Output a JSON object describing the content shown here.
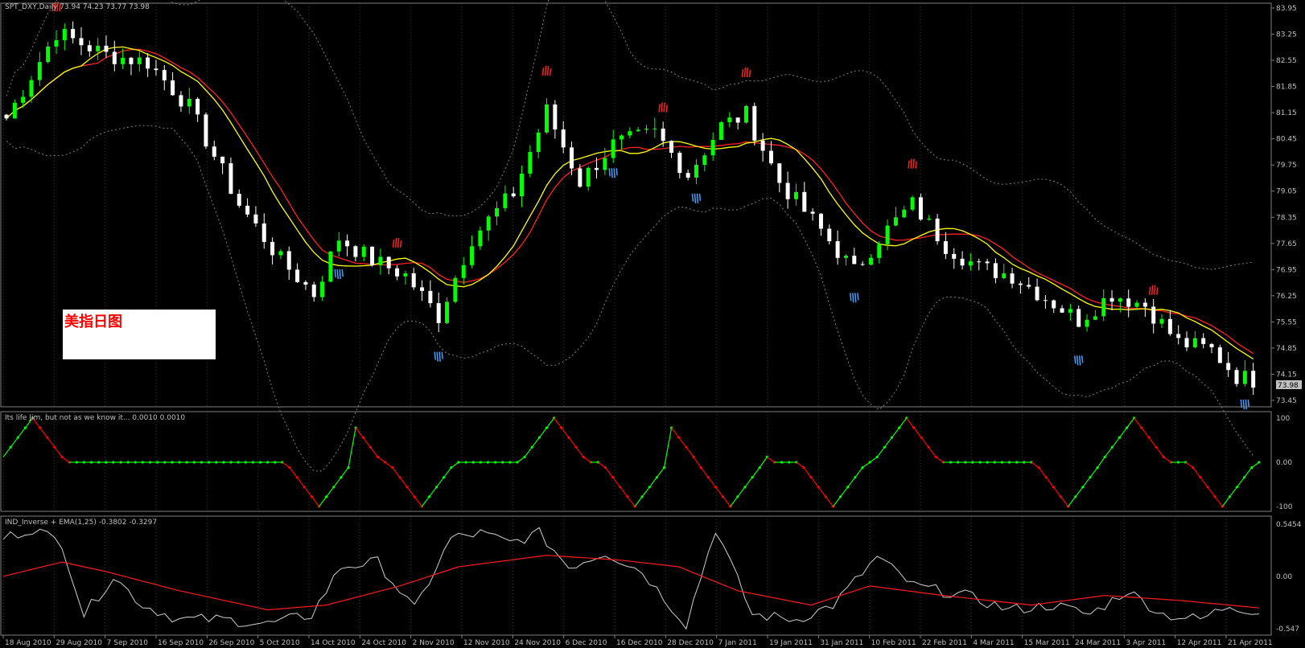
{
  "colors": {
    "background": "#000000",
    "grid": "#3a3a3a",
    "candle_up": "#00ff00",
    "candle_down": "#ffffff",
    "ma_fast": "#ffff00",
    "ma_slow": "#ff2020",
    "ma_signal": "#3fd0ff",
    "band": "#808080",
    "oscillator_up": "#00ff00",
    "oscillator_down": "#ff0000",
    "inverse_line": "#cfcfcf",
    "ema_line": "#ff1a1a",
    "marker_top": "#ff2020",
    "marker_bottom": "#3fa0ff"
  },
  "panes": {
    "main": {
      "title": "SPT_DXY,Daily  73.94 74.23 73.77 73.98",
      "last_price": "73.98",
      "y_labels": [
        "83.95",
        "83.25",
        "82.55",
        "81.85",
        "81.15",
        "80.45",
        "79.75",
        "79.05",
        "78.35",
        "77.65",
        "76.95",
        "76.25",
        "75.55",
        "74.85",
        "74.15",
        "73.45"
      ],
      "note": "美指日图"
    },
    "oscillator": {
      "title": "Its life Jim, but not as we know it...  0.0010 0.0010",
      "y_labels": [
        "100",
        "0.00",
        "-100"
      ]
    },
    "inverse": {
      "title": "IND_Inverse + EMA(1,25) -0.3802 -0.3297",
      "y_labels": [
        "0.5454",
        "0.00",
        "-0.547"
      ]
    }
  },
  "x_labels": [
    "18 Aug 2010",
    "29 Aug 2010",
    "7 Sep 2010",
    "16 Sep 2010",
    "26 Sep 2010",
    "5 Oct 2010",
    "14 Oct 2010",
    "24 Oct 2010",
    "2 Nov 2010",
    "12 Nov 2010",
    "24 Nov 2010",
    "6 Dec 2010",
    "16 Dec 2010",
    "28 Dec 2010",
    "7 Jan 2011",
    "19 Jan 2011",
    "31 Jan 2011",
    "10 Feb 2011",
    "22 Feb 2011",
    "4 Mar 2011",
    "15 Mar 2011",
    "24 Mar 2011",
    "3 Apr 2011",
    "12 Apr 2011",
    "21 Apr 2011"
  ],
  "chart_data": [
    {
      "type": "candlestick",
      "title": "SPT_DXY,Daily",
      "ylim": [
        73.45,
        83.95
      ],
      "anchors": [
        [
          0,
          81.0
        ],
        [
          6,
          83.3
        ],
        [
          12,
          82.7
        ],
        [
          17,
          82.5
        ],
        [
          22,
          81.3
        ],
        [
          28,
          78.7
        ],
        [
          33,
          77.2
        ],
        [
          37,
          76.3
        ],
        [
          40,
          77.8
        ],
        [
          44,
          77.2
        ],
        [
          48,
          76.8
        ],
        [
          52,
          75.7
        ],
        [
          56,
          77.8
        ],
        [
          61,
          79.0
        ],
        [
          65,
          81.2
        ],
        [
          69,
          79.3
        ],
        [
          73,
          80.3
        ],
        [
          78,
          80.6
        ],
        [
          82,
          79.5
        ],
        [
          86,
          80.8
        ],
        [
          89,
          81.1
        ],
        [
          93,
          79.3
        ],
        [
          98,
          78.0
        ],
        [
          102,
          76.9
        ],
        [
          105,
          77.8
        ],
        [
          109,
          78.7
        ],
        [
          113,
          77.6
        ],
        [
          117,
          77.0
        ],
        [
          121,
          76.8
        ],
        [
          125,
          76.2
        ],
        [
          129,
          75.6
        ],
        [
          133,
          76.3
        ],
        [
          137,
          76.0
        ],
        [
          141,
          75.0
        ],
        [
          145,
          74.8
        ],
        [
          148,
          74.1
        ],
        [
          150,
          74.0
        ]
      ],
      "bars": 151
    },
    {
      "type": "line",
      "name": "Its life Jim, but not as we know it...",
      "ylim": [
        -100,
        100
      ],
      "peaks": [
        4,
        47,
        75,
        90,
        100,
        123,
        154
      ],
      "troughs": [
        43,
        57,
        86,
        99,
        113,
        145,
        166
      ]
    },
    {
      "type": "line",
      "name": "IND_Inverse + EMA(1,25)",
      "ylim": [
        -0.547,
        0.5454
      ],
      "inverse_anchors": [
        [
          0,
          0.4
        ],
        [
          4,
          0.5
        ],
        [
          8,
          0.35
        ],
        [
          11,
          -0.4
        ],
        [
          15,
          0.0
        ],
        [
          19,
          -0.3
        ],
        [
          24,
          -0.45
        ],
        [
          30,
          -0.45
        ],
        [
          36,
          -0.5
        ],
        [
          42,
          -0.4
        ],
        [
          46,
          0.1
        ],
        [
          51,
          0.15
        ],
        [
          56,
          -0.35
        ],
        [
          61,
          0.4
        ],
        [
          65,
          0.45
        ],
        [
          69,
          0.35
        ],
        [
          73,
          0.45
        ],
        [
          77,
          0.1
        ],
        [
          82,
          0.25
        ],
        [
          87,
          0.05
        ],
        [
          93,
          -0.5
        ],
        [
          97,
          0.5
        ],
        [
          102,
          -0.4
        ],
        [
          108,
          -0.45
        ],
        [
          113,
          -0.3
        ],
        [
          119,
          0.2
        ],
        [
          124,
          -0.1
        ],
        [
          131,
          -0.2
        ],
        [
          137,
          -0.35
        ],
        [
          143,
          -0.3
        ],
        [
          148,
          -0.4
        ],
        [
          153,
          -0.15
        ],
        [
          158,
          -0.4
        ],
        [
          163,
          -0.45
        ],
        [
          167,
          -0.3
        ],
        [
          171,
          -0.38
        ]
      ],
      "ema_anchors": [
        [
          0,
          0.0
        ],
        [
          8,
          0.15
        ],
        [
          14,
          0.05
        ],
        [
          24,
          -0.15
        ],
        [
          36,
          -0.35
        ],
        [
          44,
          -0.3
        ],
        [
          54,
          -0.1
        ],
        [
          62,
          0.1
        ],
        [
          74,
          0.22
        ],
        [
          84,
          0.17
        ],
        [
          92,
          0.1
        ],
        [
          100,
          -0.15
        ],
        [
          110,
          -0.3
        ],
        [
          118,
          -0.1
        ],
        [
          128,
          -0.2
        ],
        [
          140,
          -0.3
        ],
        [
          150,
          -0.2
        ],
        [
          160,
          -0.25
        ],
        [
          171,
          -0.33
        ]
      ]
    }
  ]
}
